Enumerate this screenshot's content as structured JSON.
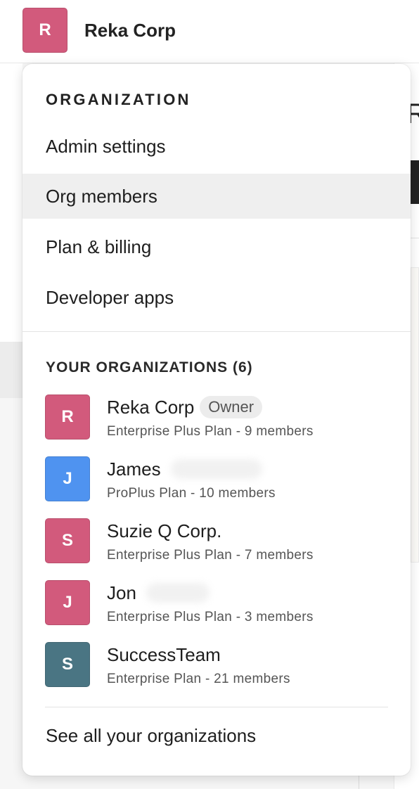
{
  "header": {
    "org_initial": "R",
    "org_name": "Reka Corp",
    "avatar_color": "#d25a7c"
  },
  "background": {
    "partial_letter": "R"
  },
  "menu": {
    "section_heading": "ORGANIZATION",
    "items": [
      {
        "label": "Admin settings",
        "active": false
      },
      {
        "label": "Org members",
        "active": true
      },
      {
        "label": "Plan & billing",
        "active": false
      },
      {
        "label": "Developer apps",
        "active": false
      }
    ],
    "orgs_heading": "YOUR ORGANIZATIONS (6)",
    "orgs": [
      {
        "initial": "R",
        "name": "Reka Corp",
        "badge": "Owner",
        "plan": "Enterprise Plus Plan - 9 members",
        "color": "#d25a7c"
      },
      {
        "initial": "J",
        "name": "James",
        "plan": "ProPlus Plan - 10 members",
        "color": "#4f93f0"
      },
      {
        "initial": "S",
        "name": "Suzie Q Corp.",
        "plan": "Enterprise Plus Plan - 7 members",
        "color": "#d25a7c"
      },
      {
        "initial": "J",
        "name": "Jon",
        "plan": "Enterprise Plus Plan - 3 members",
        "color": "#d25a7c"
      },
      {
        "initial": "S",
        "name": "SuccessTeam",
        "plan": "Enterprise Plan - 21 members",
        "color": "#4a7583"
      }
    ],
    "see_all_label": "See all your organizations"
  },
  "colors": {
    "active_item_bg": "#efefef",
    "pink_avatar": "#d25a7c",
    "blue_avatar": "#4f93f0",
    "teal_avatar": "#4a7583"
  }
}
